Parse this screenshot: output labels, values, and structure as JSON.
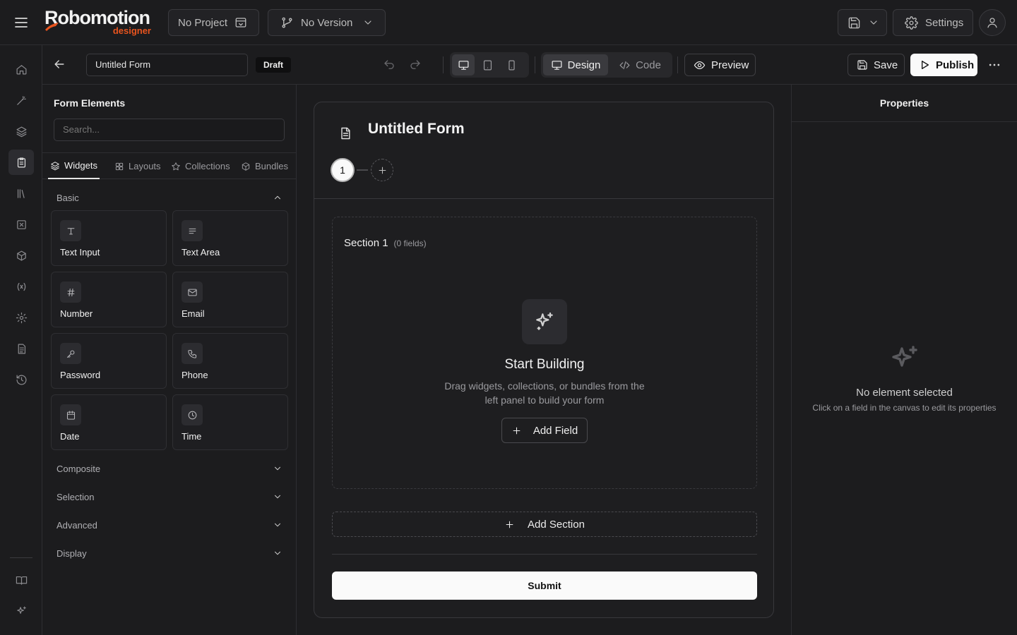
{
  "brand": {
    "name": "Robomotion",
    "sub": "designer",
    "accent": "#e8541e"
  },
  "topbar": {
    "project": "No Project",
    "version": "No Version",
    "settings": "Settings"
  },
  "form_bar": {
    "form_name": "Untitled Form",
    "status": "Draft",
    "view_design": "Design",
    "view_code": "Code",
    "preview": "Preview",
    "save": "Save",
    "publish": "Publish"
  },
  "left_panel": {
    "title": "Form Elements",
    "search_placeholder": "Search...",
    "tabs": [
      "Widgets",
      "Layouts",
      "Collections",
      "Bundles"
    ],
    "active_tab": "Widgets",
    "groups": {
      "basic": "Basic",
      "composite": "Composite",
      "selection": "Selection",
      "advanced": "Advanced",
      "display": "Display"
    },
    "widgets": [
      {
        "label": "Text Input",
        "icon": "type-icon"
      },
      {
        "label": "Text Area",
        "icon": "align-left-icon"
      },
      {
        "label": "Number",
        "icon": "hash-icon"
      },
      {
        "label": "Email",
        "icon": "mail-icon"
      },
      {
        "label": "Password",
        "icon": "key-icon"
      },
      {
        "label": "Phone",
        "icon": "phone-icon"
      },
      {
        "label": "Date",
        "icon": "calendar-icon"
      },
      {
        "label": "Time",
        "icon": "clock-icon"
      }
    ]
  },
  "canvas": {
    "form_title": "Untitled Form",
    "step_number": "1",
    "section_title": "Section 1",
    "section_count": "(0 fields)",
    "empty_title": "Start Building",
    "empty_line1": "Drag widgets, collections, or bundles from the",
    "empty_line2": "left panel to build your form",
    "add_field": "Add Field",
    "add_section": "Add Section",
    "submit": "Submit"
  },
  "right_panel": {
    "title": "Properties",
    "empty_title": "No element selected",
    "empty_desc": "Click on a field in the canvas to edit its properties"
  }
}
